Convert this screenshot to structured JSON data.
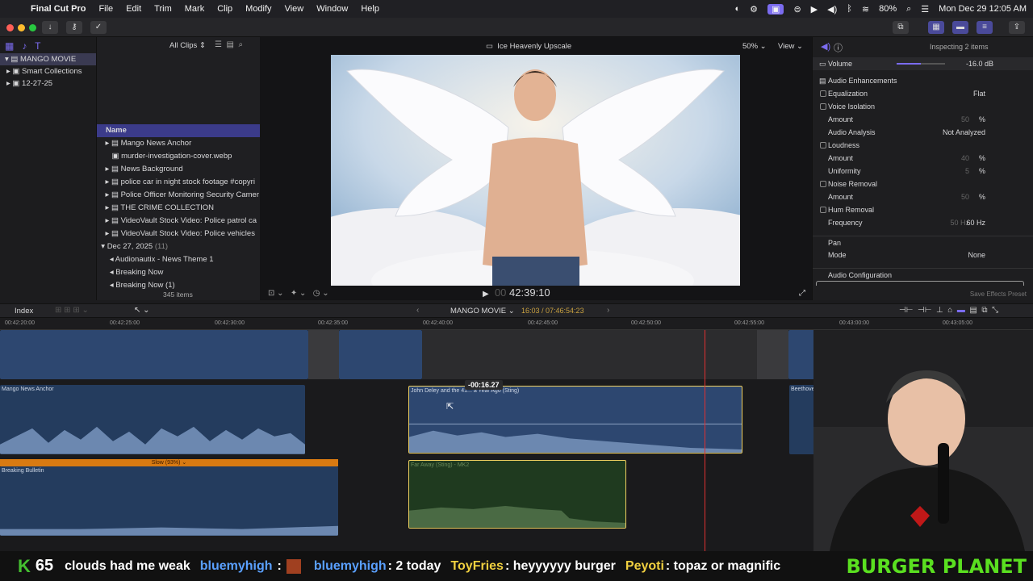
{
  "menubar": {
    "app": "Final Cut Pro",
    "menus": [
      "File",
      "Edit",
      "Trim",
      "Mark",
      "Clip",
      "Modify",
      "View",
      "Window",
      "Help"
    ],
    "battery": "80%",
    "clock": "Mon Dec 29  12:05 AM"
  },
  "library": {
    "name": "MANGO MOVIE",
    "items": [
      "Smart Collections",
      "12-27-25"
    ]
  },
  "browser": {
    "filter": "All Clips",
    "column": "Name",
    "items": [
      "Mango News Anchor",
      "murder-investigation-cover.webp",
      "News Background",
      "police  car in night stock footage #copyri",
      "Police Officer Monitoring Security Camer",
      "THE CRIME COLLECTION",
      "VideoVault Stock Video:  Police patrol ca",
      "VideoVault Stock Video:  Police vehicles"
    ],
    "date_group": "Dec 27, 2025",
    "date_count": "(11)",
    "sub_items": [
      "Audionautix - News Theme 1",
      "Breaking Now",
      "Breaking Now (1)"
    ],
    "count": "345 items"
  },
  "viewer": {
    "title": "Ice Heavenly Upscale",
    "zoom": "50%",
    "view": "View",
    "timecode": "42:39:10",
    "timecode_prefix": "00"
  },
  "inspector": {
    "header": "Inspecting 2 items",
    "volume_label": "Volume",
    "volume": "-16.0  dB",
    "section": "Audio Enhancements",
    "rows": [
      {
        "k": "Equalization",
        "v": "Flat",
        "check": true
      },
      {
        "k": "Voice Isolation",
        "v": "",
        "check": true
      },
      {
        "k": "Amount",
        "v": "%",
        "check": false,
        "num": "50"
      },
      {
        "k": "Audio Analysis",
        "v": "Not Analyzed",
        "check": false
      },
      {
        "k": "Loudness",
        "v": "",
        "check": true
      },
      {
        "k": "Amount",
        "v": "%",
        "check": false,
        "num": "40"
      },
      {
        "k": "Uniformity",
        "v": "%",
        "check": false,
        "num": "5"
      },
      {
        "k": "Noise Removal",
        "v": "",
        "check": true
      },
      {
        "k": "Amount",
        "v": "%",
        "check": false,
        "num": "50"
      },
      {
        "k": "Hum Removal",
        "v": "",
        "check": true
      },
      {
        "k": "Frequency",
        "v": "60 Hz",
        "check": false,
        "num": "50 Hz"
      }
    ],
    "pan": "Pan",
    "mode_label": "Mode",
    "mode": "None",
    "audio_config": "Audio Configuration",
    "save_preset": "Save Effects Preset"
  },
  "timeline": {
    "index": "Index",
    "project": "MANGO MOVIE",
    "duration": "16:03 / 07:46:54:23",
    "ruler": [
      "00:42:20:00",
      "00:42:25:00",
      "00:42:30:00",
      "00:42:35:00",
      "00:42:40:00",
      "00:42:45:00",
      "00:42:50:00",
      "00:42:55:00",
      "00:43:00:00",
      "00:43:05:00"
    ],
    "drag_time": "-00:16.27",
    "clips": {
      "anchor": "Mango News Anchor",
      "sting": "John Deley and the 41... a Year Ago (Sting)",
      "beethoven": "Beethoven - Moonlight Sonata (by",
      "speed": "Slow (93%)",
      "bulletin": "Breaking Bulletin",
      "far_away": "Far Away (Sting) - MK2"
    }
  },
  "ticker": {
    "count": "65",
    "messages": [
      {
        "user": "",
        "text": "clouds had me weak"
      },
      {
        "user": "bluemyhigh",
        "text": ":"
      },
      {
        "user": "bluemyhigh",
        "text": ": 2 today"
      },
      {
        "user": "ToyFries",
        "text": ": heyyyyyy burger"
      },
      {
        "user": "Peyoti",
        "text": ": topaz or magnific"
      }
    ],
    "brand": "BURGER PLANET"
  },
  "colors": {
    "accent": "#7b6cf0",
    "selection": "#f0d060",
    "clip_blue": "#2d4770",
    "clip_green": "#1f3a1f",
    "speed_bar": "#d87a12",
    "playhead": "#e03030"
  }
}
